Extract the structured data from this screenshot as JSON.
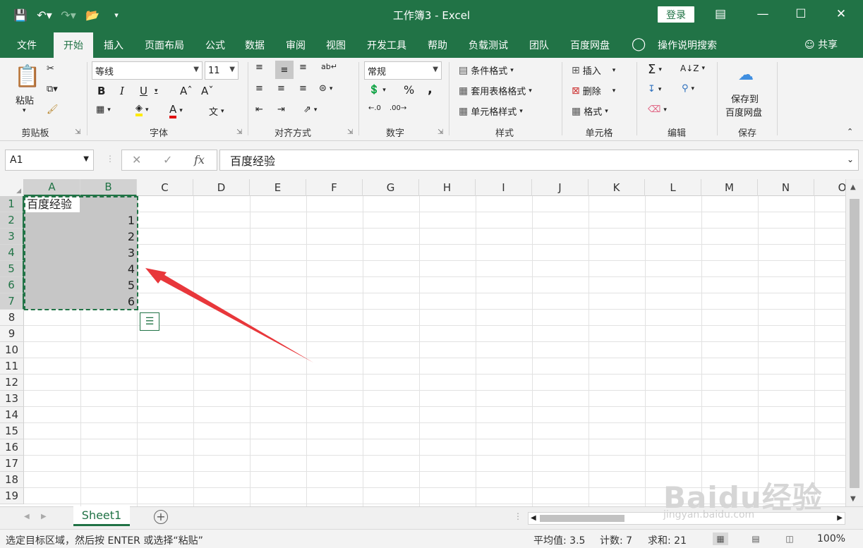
{
  "window": {
    "title": "工作簿3  -  Excel",
    "login_label": "登录"
  },
  "menu": {
    "tabs": [
      "文件",
      "开始",
      "插入",
      "页面布局",
      "公式",
      "数据",
      "审阅",
      "视图",
      "开发工具",
      "帮助",
      "负载测试",
      "团队",
      "百度网盘"
    ],
    "active_tab": "开始",
    "tell_me": "操作说明搜索",
    "share": "共享"
  },
  "ribbon": {
    "clipboard": {
      "paste": "粘贴",
      "label": "剪贴板"
    },
    "font": {
      "name": "等线",
      "size": "11",
      "label": "字体"
    },
    "alignment": {
      "label": "对齐方式"
    },
    "number": {
      "format": "常规",
      "label": "数字",
      "percent": "%",
      "comma": ","
    },
    "styles": {
      "conditional": "条件格式",
      "table": "套用表格格式",
      "cell": "单元格样式",
      "label": "样式"
    },
    "cells": {
      "insert": "插入",
      "delete": "删除",
      "format": "格式",
      "label": "单元格"
    },
    "editing": {
      "label": "编辑"
    },
    "save": {
      "line1": "保存到",
      "line2": "百度网盘",
      "label": "保存"
    }
  },
  "formula_bar": {
    "name_box": "A1",
    "content": "百度经验"
  },
  "grid": {
    "columns": [
      "A",
      "B",
      "C",
      "D",
      "E",
      "F",
      "G",
      "H",
      "I",
      "J",
      "K",
      "L",
      "M",
      "N",
      "O"
    ],
    "rows": [
      "1",
      "2",
      "3",
      "4",
      "5",
      "6",
      "7",
      "8",
      "9",
      "10",
      "11",
      "12",
      "13",
      "14",
      "15",
      "16",
      "17",
      "18",
      "19"
    ],
    "a1": "百度经验",
    "b_values": [
      "1",
      "2",
      "3",
      "4",
      "5",
      "6"
    ],
    "selected_columns": [
      "A",
      "B"
    ],
    "selected_rows": 7
  },
  "sheets": {
    "active": "Sheet1"
  },
  "status": {
    "message": "选定目标区域，然后按 ENTER 或选择“粘贴”",
    "average": "平均值: 3.5",
    "count": "计数: 7",
    "sum": "求和: 21",
    "zoom": "100%"
  },
  "watermark": {
    "text": "Baidu经验",
    "url": "jingyan.baidu.com"
  }
}
